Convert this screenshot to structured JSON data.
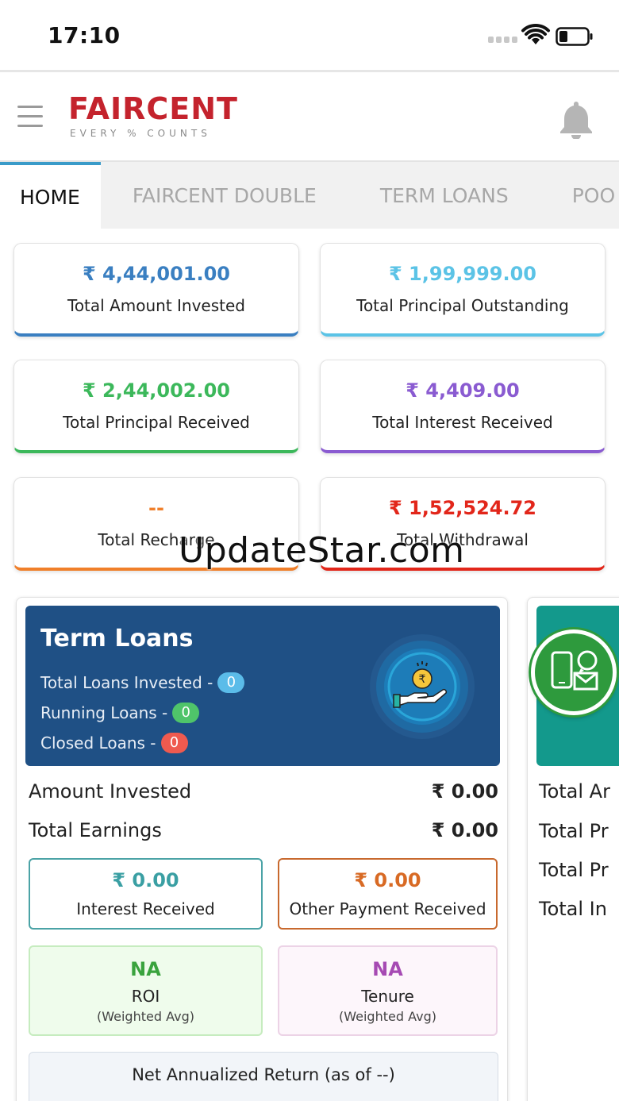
{
  "status_bar": {
    "time": "17:10"
  },
  "header": {
    "logo_text": "FAIRCENT",
    "logo_tagline": "EVERY % COUNTS"
  },
  "tabs": [
    {
      "label": "HOME",
      "active": true
    },
    {
      "label": "FAIRCENT DOUBLE",
      "active": false
    },
    {
      "label": "TERM LOANS",
      "active": false
    },
    {
      "label": "POO",
      "active": false
    }
  ],
  "summary_cards": [
    {
      "value": "₹ 4,44,001.00",
      "label": "Total Amount Invested",
      "color": "#3a7fc1"
    },
    {
      "value": "₹ 1,99,999.00",
      "label": "Total Principal Outstanding",
      "color": "#5bc3e6"
    },
    {
      "value": "₹ 2,44,002.00",
      "label": "Total Principal Received",
      "color": "#3cb85b"
    },
    {
      "value": "₹ 4,409.00",
      "label": "Total Interest Received",
      "color": "#8a5bd1"
    },
    {
      "value": "--",
      "label": "Total Recharge",
      "color": "#f07f2a"
    },
    {
      "value": "₹ 1,52,524.72",
      "label": "Total Withdrawal",
      "color": "#e2261a"
    }
  ],
  "term_loans": {
    "title": "Term Loans",
    "total_loans_label": "Total Loans Invested -",
    "total_loans_count": "0",
    "running_loans_label": "Running Loans -",
    "running_loans_count": "0",
    "closed_loans_label": "Closed Loans -",
    "closed_loans_count": "0",
    "amount_invested_label": "Amount Invested",
    "amount_invested_value": "₹ 0.00",
    "total_earnings_label": "Total Earnings",
    "total_earnings_value": "₹ 0.00",
    "interest_received_value": "₹ 0.00",
    "interest_received_label": "Interest Received",
    "other_payment_value": "₹ 0.00",
    "other_payment_label": "Other Payment Received",
    "roi_value": "NA",
    "roi_label": "ROI",
    "roi_sub": "(Weighted Avg)",
    "tenure_value": "NA",
    "tenure_label": "Tenure",
    "tenure_sub": "(Weighted Avg)",
    "net_return_label": "Net Annualized Return (as of --)"
  },
  "second_panel": {
    "rows": [
      "Total Ar",
      "Total Pr",
      "Total Pr",
      "Total In"
    ]
  },
  "watermark": "UpdateStar.com"
}
